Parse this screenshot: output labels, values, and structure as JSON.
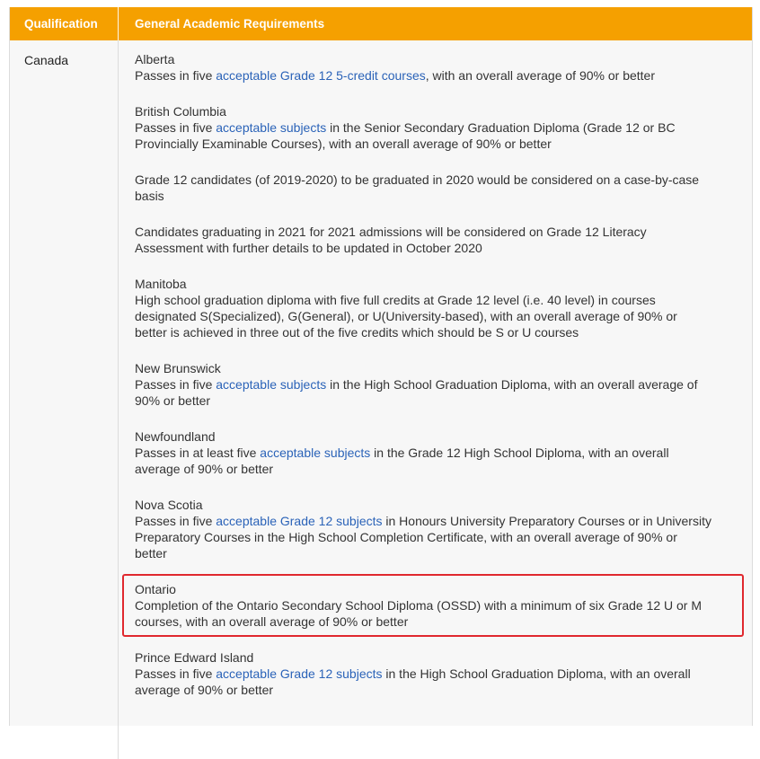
{
  "header": {
    "qualification": "Qualification",
    "requirements": "General Academic Requirements"
  },
  "row": {
    "country": "Canada"
  },
  "provinces": [
    {
      "name": "Alberta",
      "line1_pre": "Passes in five ",
      "line1_link": "acceptable Grade 12 5-credit courses",
      "line1_post": ", with an overall average of 90% or better"
    },
    {
      "name": "British Columbia",
      "pre": "Passes in five ",
      "link": "acceptable subjects",
      "post_l1": " in the Senior Secondary Graduation Diploma (Grade 12 or BC",
      "line2": "Provincially Examinable Courses), with an overall average of 90% or better"
    },
    {
      "line1": "Grade 12 candidates (of 2019-2020) to be graduated in 2020 would be considered on a case-by-case",
      "line2": "basis"
    },
    {
      "line1": "Candidates graduating in 2021 for 2021 admissions will be considered on Grade 12 Literacy",
      "line2": "Assessment with further details to be updated in October 2020"
    },
    {
      "name": "Manitoba",
      "line1": "High school graduation diploma with five full credits at Grade 12 level (i.e. 40 level) in courses",
      "line2": "designated S(Specialized), G(General), or U(University-based), with an overall average of 90% or",
      "line3": "better is achieved in three out of the five credits which should be S or U courses"
    },
    {
      "name": "New Brunswick",
      "pre": "Passes in five ",
      "link": "acceptable subjects",
      "post_l1": " in the High School Graduation Diploma, with an overall average of",
      "line2": "90% or better"
    },
    {
      "name": "Newfoundland",
      "pre": "Passes in at least five ",
      "link": "acceptable subjects",
      "post_l1": " in the Grade 12 High School Diploma, with an overall",
      "line2": "average of 90% or better"
    },
    {
      "name": "Nova Scotia",
      "pre": "Passes in five ",
      "link": "acceptable Grade 12 subjects",
      "post_l1": " in Honours University Preparatory Courses or in University",
      "line2": "Preparatory Courses in the High School Completion Certificate, with an overall average of 90% or",
      "line3": "better"
    },
    {
      "name": "Ontario",
      "line1": "Completion of the Ontario Secondary School Diploma (OSSD) with a minimum of six Grade 12 U or M",
      "line2": "courses, with an overall average of 90% or better"
    },
    {
      "name": "Prince Edward Island",
      "pre": "Passes in five ",
      "link": "acceptable Grade 12 subjects",
      "post_l1": " in the High School Graduation Diploma, with an overall",
      "line2": "average of 90% or better"
    }
  ],
  "colors": {
    "header_bg": "#f5a000",
    "link": "#2b63b8",
    "highlight_border": "#e0282e"
  }
}
